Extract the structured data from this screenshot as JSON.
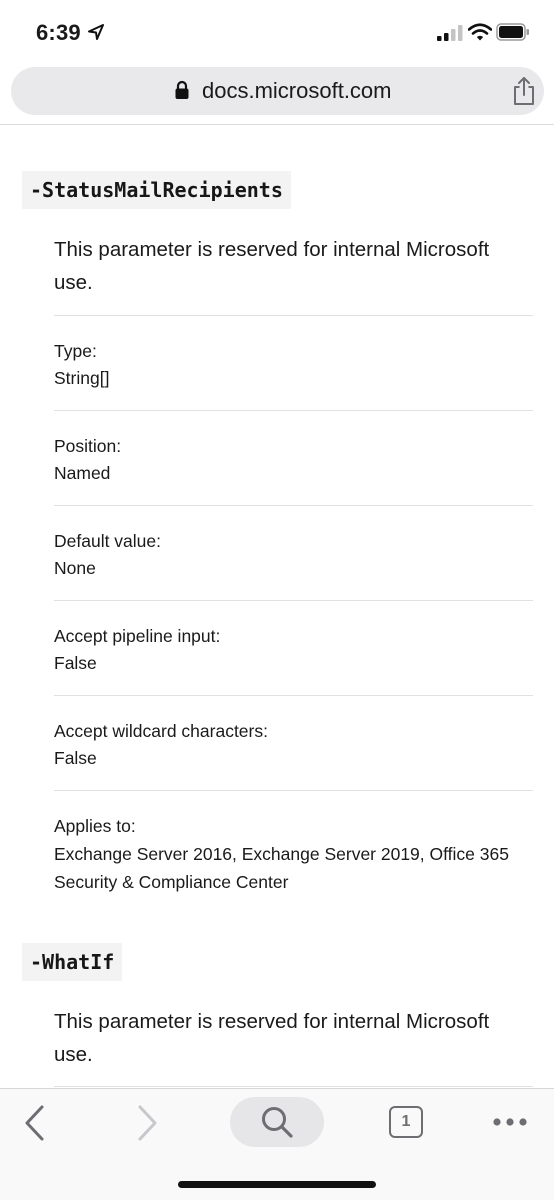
{
  "status_bar": {
    "time": "6:39",
    "icons": [
      "location-arrow-icon",
      "cellular-signal-icon",
      "wifi-icon",
      "battery-icon"
    ]
  },
  "browser": {
    "url": "docs.microsoft.com",
    "icons": [
      "lock-icon",
      "share-icon"
    ]
  },
  "sections": [
    {
      "heading": "-StatusMailRecipients",
      "description": "This parameter is reserved for internal Microsoft use.",
      "properties": [
        {
          "label": "Type:",
          "value": "String[]"
        },
        {
          "label": "Position:",
          "value": "Named"
        },
        {
          "label": "Default value:",
          "value": "None"
        },
        {
          "label": "Accept pipeline input:",
          "value": "False"
        },
        {
          "label": "Accept wildcard characters:",
          "value": "False"
        },
        {
          "label": "Applies to:",
          "value": "Exchange Server 2016, Exchange Server 2019, Office 365 Security & Compliance Center"
        }
      ]
    },
    {
      "heading": "-WhatIf",
      "description": "This parameter is reserved for internal Microsoft use."
    }
  ],
  "toolbar": {
    "tab_count": "1",
    "icons": [
      "back-icon",
      "forward-icon",
      "search-icon",
      "tabs-icon",
      "more-icon"
    ]
  }
}
